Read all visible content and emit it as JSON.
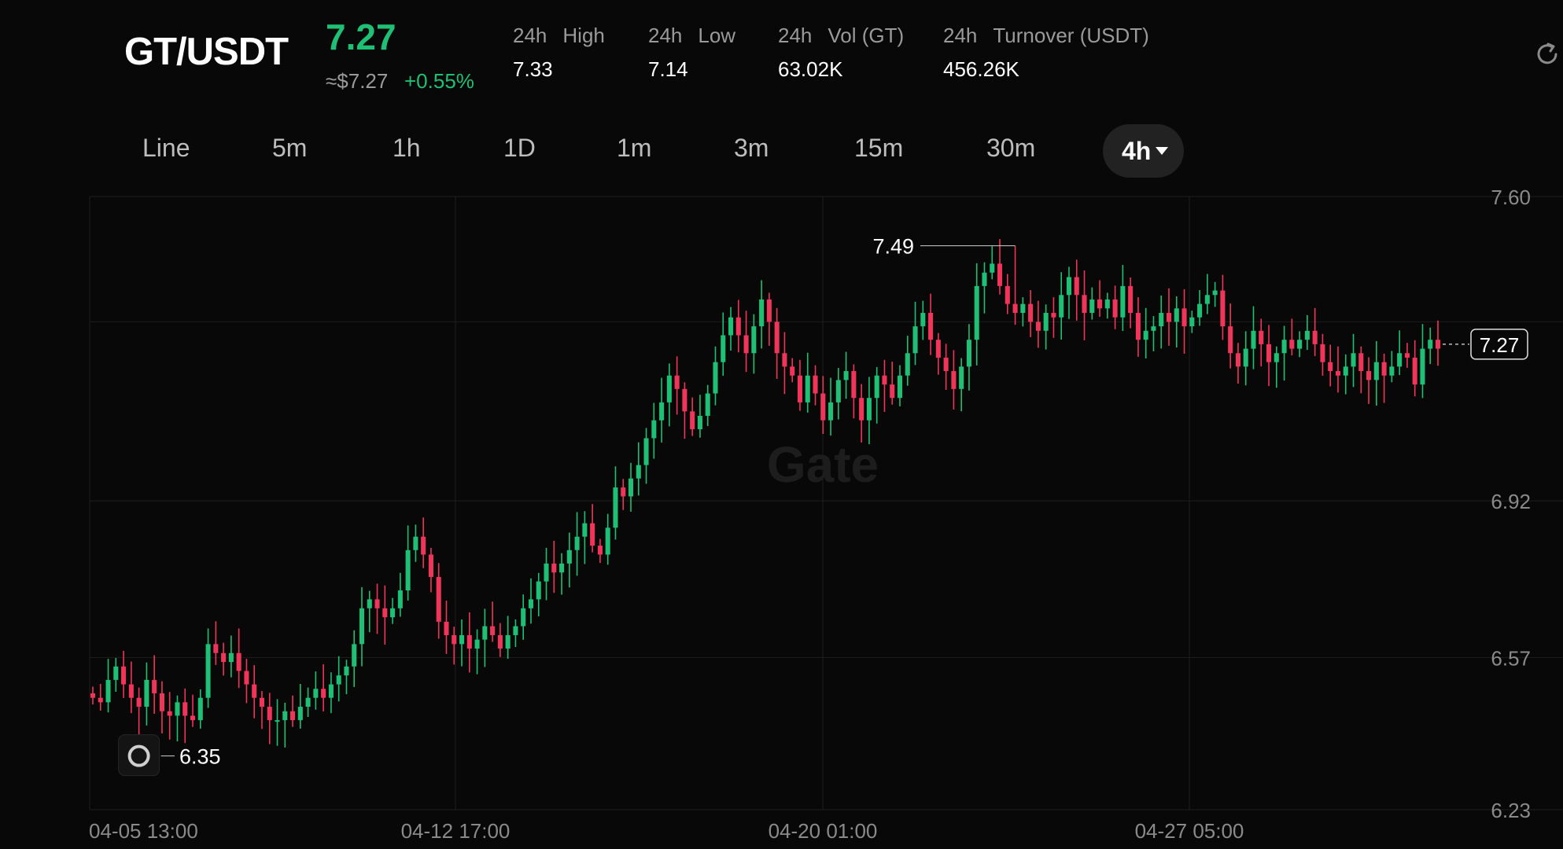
{
  "header": {
    "pair": "GT/USDT",
    "price": "7.27",
    "usd_approx": "≈$7.27",
    "change_pct": "+0.55%",
    "stats": [
      {
        "prefix": "24h",
        "label": "High",
        "value": "7.33"
      },
      {
        "prefix": "24h",
        "label": "Low",
        "value": "7.14"
      },
      {
        "prefix": "24h",
        "label": "Vol (GT)",
        "value": "63.02K"
      },
      {
        "prefix": "24h",
        "label": "Turnover (USDT)",
        "value": "456.26K"
      }
    ]
  },
  "tabs": [
    "Line",
    "5m",
    "1h",
    "1D",
    "1m",
    "3m",
    "15m",
    "30m",
    "4h"
  ],
  "active_tab": "4h",
  "colors": {
    "up": "#1fbf75",
    "down": "#f0355a",
    "background": "#080808",
    "grid": "#1e1e1e"
  },
  "chart_data": {
    "type": "candlestick",
    "y_ticks": [
      "7.60",
      "6.92",
      "6.57",
      "6.23"
    ],
    "y_range": [
      6.23,
      7.6
    ],
    "x_labels": [
      "04-05 13:00",
      "04-12 17:00",
      "04-20 01:00",
      "04-27 05:00"
    ],
    "current_price_label": "7.27",
    "max_marker": "7.49",
    "min_marker": "6.35",
    "watermark": "Gate",
    "closes": [
      6.48,
      6.47,
      6.52,
      6.55,
      6.51,
      6.48,
      6.46,
      6.52,
      6.49,
      6.45,
      6.44,
      6.47,
      6.44,
      6.43,
      6.48,
      6.6,
      6.58,
      6.56,
      6.58,
      6.54,
      6.51,
      6.48,
      6.46,
      6.43,
      6.43,
      6.45,
      6.43,
      6.46,
      6.48,
      6.5,
      6.48,
      6.51,
      6.53,
      6.55,
      6.6,
      6.68,
      6.7,
      6.68,
      6.66,
      6.68,
      6.72,
      6.81,
      6.84,
      6.8,
      6.75,
      6.65,
      6.62,
      6.6,
      6.62,
      6.59,
      6.61,
      6.64,
      6.62,
      6.59,
      6.62,
      6.64,
      6.68,
      6.7,
      6.74,
      6.78,
      6.76,
      6.78,
      6.81,
      6.84,
      6.87,
      6.82,
      6.8,
      6.86,
      6.95,
      6.93,
      6.97,
      7.0,
      7.06,
      7.1,
      7.14,
      7.2,
      7.17,
      7.12,
      7.08,
      7.11,
      7.16,
      7.23,
      7.29,
      7.33,
      7.29,
      7.25,
      7.31,
      7.37,
      7.32,
      7.25,
      7.22,
      7.2,
      7.14,
      7.2,
      7.16,
      7.1,
      7.14,
      7.19,
      7.21,
      7.15,
      7.1,
      7.15,
      7.2,
      7.18,
      7.15,
      7.2,
      7.25,
      7.31,
      7.34,
      7.28,
      7.24,
      7.21,
      7.17,
      7.22,
      7.28,
      7.4,
      7.43,
      7.45,
      7.4,
      7.36,
      7.34,
      7.36,
      7.32,
      7.3,
      7.34,
      7.33,
      7.38,
      7.42,
      7.38,
      7.34,
      7.37,
      7.35,
      7.37,
      7.33,
      7.4,
      7.34,
      7.28,
      7.3,
      7.31,
      7.34,
      7.32,
      7.35,
      7.31,
      7.33,
      7.36,
      7.38,
      7.39,
      7.31,
      7.25,
      7.22,
      7.26,
      7.3,
      7.27,
      7.23,
      7.25,
      7.28,
      7.26,
      7.28,
      7.3,
      7.27,
      7.23,
      7.21,
      7.2,
      7.22,
      7.25,
      7.21,
      7.19,
      7.23,
      7.2,
      7.22,
      7.25,
      7.24,
      7.18,
      7.26,
      7.28,
      7.26
    ],
    "high": 7.49,
    "low": 6.35
  }
}
